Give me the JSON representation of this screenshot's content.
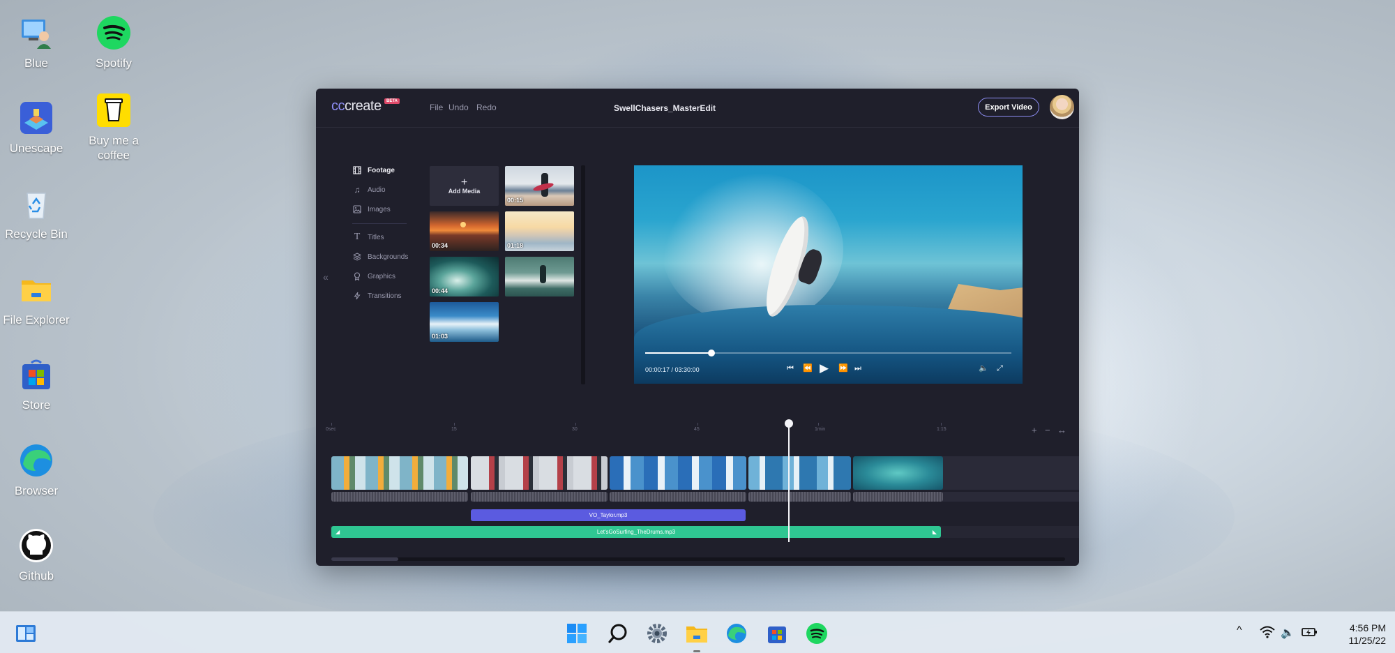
{
  "desktop": {
    "icons": [
      {
        "label": "Blue"
      },
      {
        "label": "Spotify"
      },
      {
        "label": "Unescape"
      },
      {
        "label": "Buy me a coffee"
      },
      {
        "label": "Recycle Bin"
      },
      {
        "label": "File Explorer"
      },
      {
        "label": "Store"
      },
      {
        "label": "Browser"
      },
      {
        "label": "Github"
      }
    ]
  },
  "app": {
    "logo_prefix": "cc",
    "logo_rest": "create",
    "beta": "BETA",
    "menu": [
      "File",
      "Undo",
      "Redo"
    ],
    "project_title": "SwellChasers_MasterEdit",
    "export_label": "Export Video",
    "accent": "#8f8ff7",
    "sidebar": {
      "collapse_icon": "«",
      "items": [
        {
          "label": "Footage",
          "icon": "film-icon",
          "active": true
        },
        {
          "label": "Audio",
          "icon": "music-note-icon",
          "active": false
        },
        {
          "label": "Images",
          "icon": "image-icon",
          "active": false
        },
        {
          "label": "Titles",
          "icon": "text-icon",
          "active": false
        },
        {
          "label": "Backgrounds",
          "icon": "layers-icon",
          "active": false
        },
        {
          "label": "Graphics",
          "icon": "award-icon",
          "active": false
        },
        {
          "label": "Transitions",
          "icon": "lightning-icon",
          "active": false
        }
      ]
    },
    "media": {
      "add_label": "Add Media",
      "add_icon": "+",
      "thumbs": [
        {
          "duration": "00:15"
        },
        {
          "duration": "00:34"
        },
        {
          "duration": "01:18"
        },
        {
          "duration": "00:44"
        },
        {
          "duration": ""
        },
        {
          "duration": "01:03"
        }
      ]
    },
    "preview": {
      "time": "00:00:17 / 03:30:00",
      "progress": 0.18,
      "controls": {
        "skip_back": "⏮",
        "rewind": "⏪",
        "play": "▶",
        "forward": "⏩",
        "skip_forward": "⏭",
        "volume": "🔈",
        "fullscreen": "⤢"
      }
    },
    "timeline": {
      "ruler": [
        "0sec",
        "15",
        "30",
        "45",
        "1min",
        "1:15"
      ],
      "zoom_in": "+",
      "zoom_out": "−",
      "fit": "↔",
      "vo_track": "VO_Taylor.mp3",
      "music_track": "Let'sGoSurfing_TheDrums.mp3",
      "music_fade_in": "◢",
      "music_fade_out": "◣"
    }
  },
  "taskbar": {
    "time": "4:56 PM",
    "date": "11/25/22",
    "tray": {
      "chevron": "^",
      "wifi": "wifi-icon",
      "volume": "🔈",
      "battery": "battery-icon"
    }
  }
}
